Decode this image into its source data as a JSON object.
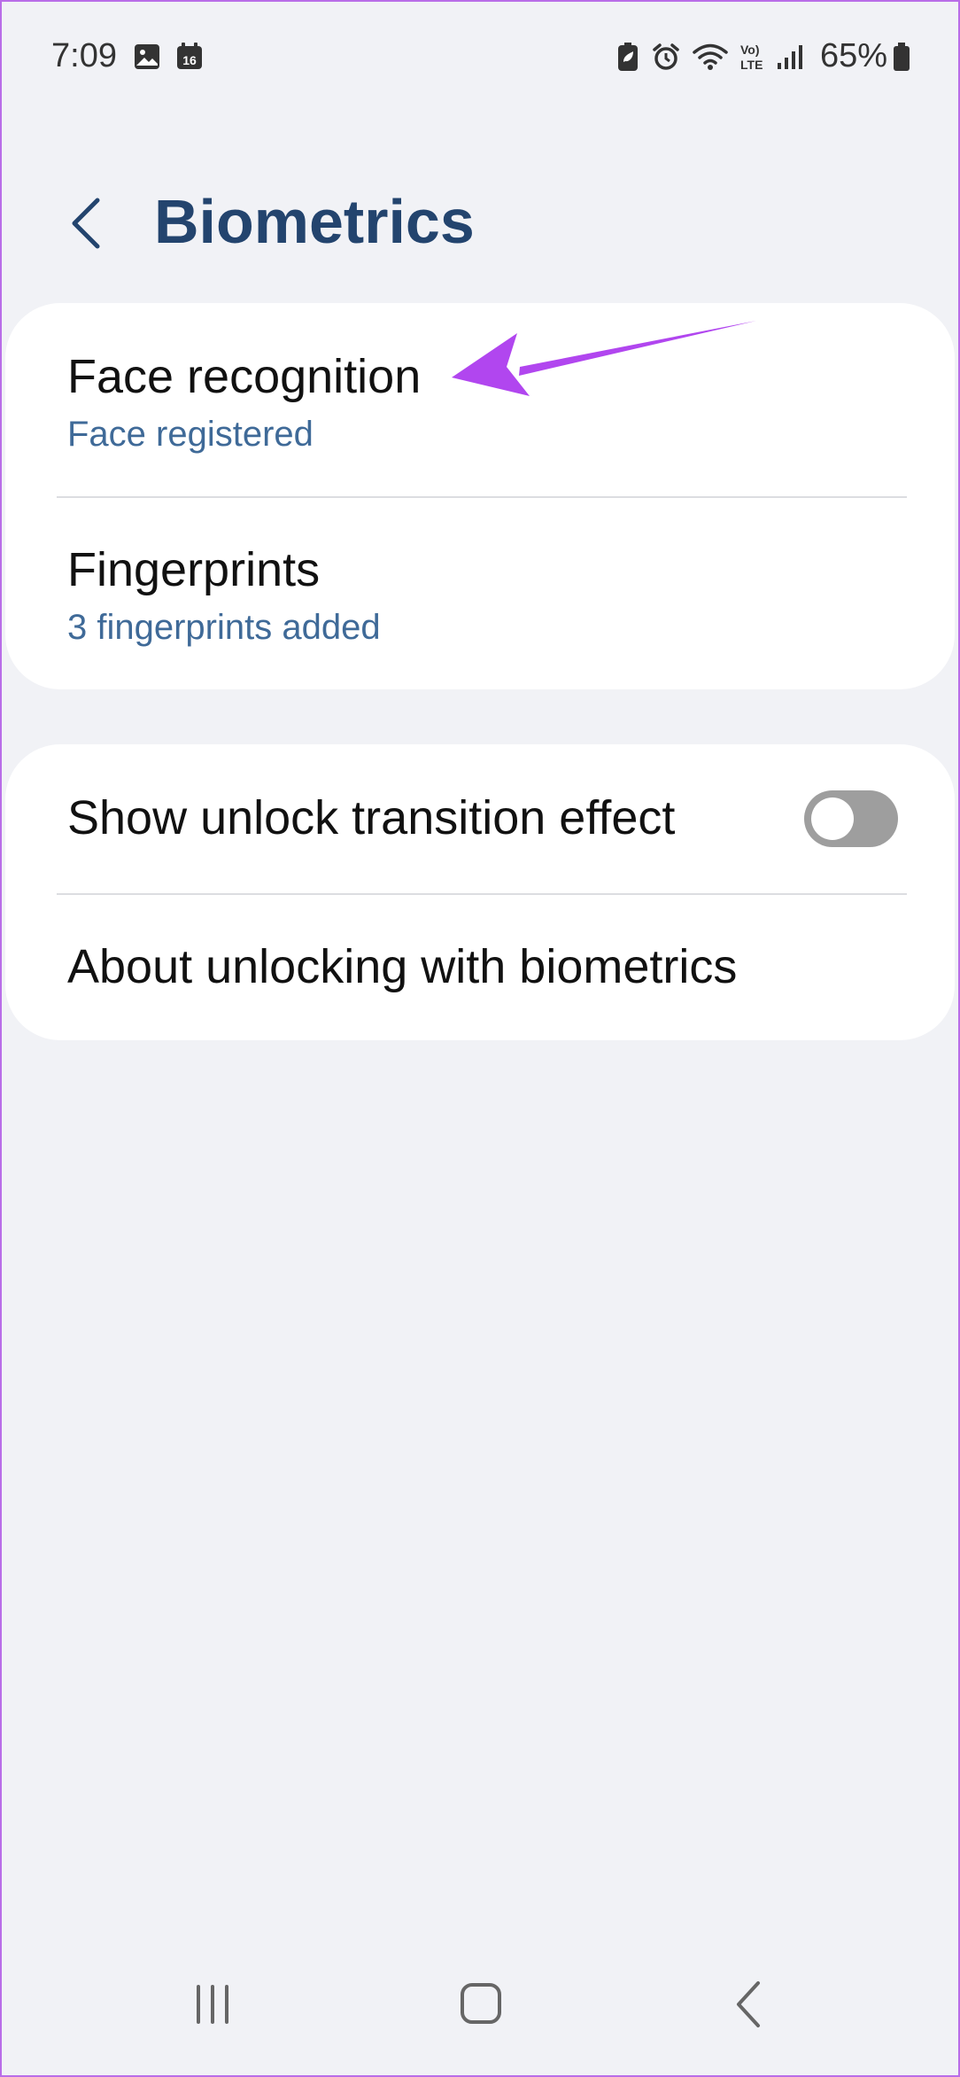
{
  "status_bar": {
    "time": "7:09",
    "battery_percent": "65%",
    "left_icons": [
      "gallery-icon",
      "calendar-icon"
    ],
    "calendar_day": "16",
    "right_icons": [
      "battery-saver-icon",
      "alarm-icon",
      "wifi-icon",
      "volte-icon",
      "signal-icon",
      "battery-icon"
    ],
    "volte_label_top": "Vo)",
    "volte_label_bottom": "LTE"
  },
  "header": {
    "title": "Biometrics",
    "back_icon": "chevron-left-icon"
  },
  "biometrics_card": {
    "items": [
      {
        "title": "Face recognition",
        "subtitle": "Face registered"
      },
      {
        "title": "Fingerprints",
        "subtitle": "3 fingerprints added"
      }
    ]
  },
  "options_card": {
    "transition_effect": {
      "label": "Show unlock transition effect",
      "enabled": false
    },
    "about": {
      "label": "About unlocking with biometrics"
    }
  },
  "annotation": {
    "type": "arrow",
    "color": "#b146ef",
    "target": "Face recognition"
  },
  "nav_bar": {
    "buttons": [
      "recent-apps-icon",
      "home-icon",
      "back-icon"
    ]
  },
  "colors": {
    "background": "#f1f2f6",
    "card": "#ffffff",
    "title": "#23446e",
    "subtitle": "#3f6a98",
    "toggle_off": "#9e9e9e",
    "frame_border": "#b96de8"
  }
}
